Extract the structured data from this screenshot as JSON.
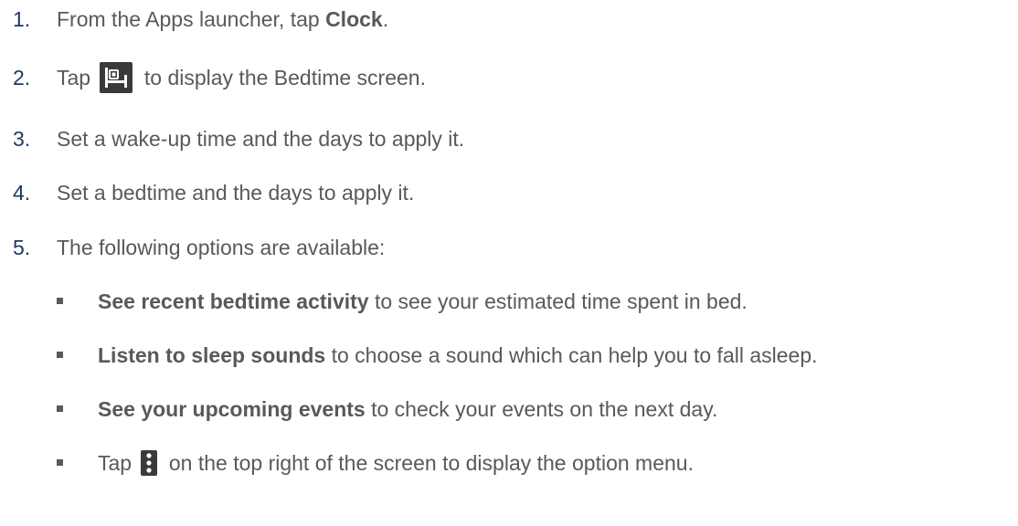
{
  "steps": [
    {
      "num": "1.",
      "pre": "From the Apps launcher, tap ",
      "bold": "Clock",
      "post": "."
    },
    {
      "num": "2.",
      "pre": "Tap ",
      "icon": "bed-icon",
      "post": " to display the Bedtime screen."
    },
    {
      "num": "3.",
      "text": "Set a wake-up time and the days to apply it."
    },
    {
      "num": "4.",
      "text": "Set a bedtime and the days to apply it."
    },
    {
      "num": "5.",
      "text": "The following options are available:"
    }
  ],
  "options": [
    {
      "bold": "See recent bedtime activity",
      "post": " to see your estimated time spent in bed."
    },
    {
      "bold": "Listen to sleep sounds",
      "post": " to choose a sound which can help you to fall asleep."
    },
    {
      "bold": "See your upcoming events",
      "post": " to check your events on the next day."
    },
    {
      "pre": "Tap ",
      "icon": "more-vert-icon",
      "post": " on the top right of the screen to display the option menu."
    }
  ],
  "colors": {
    "text": "#595959",
    "number": "#1f3864",
    "icon_bg": "#3a3a3a"
  }
}
